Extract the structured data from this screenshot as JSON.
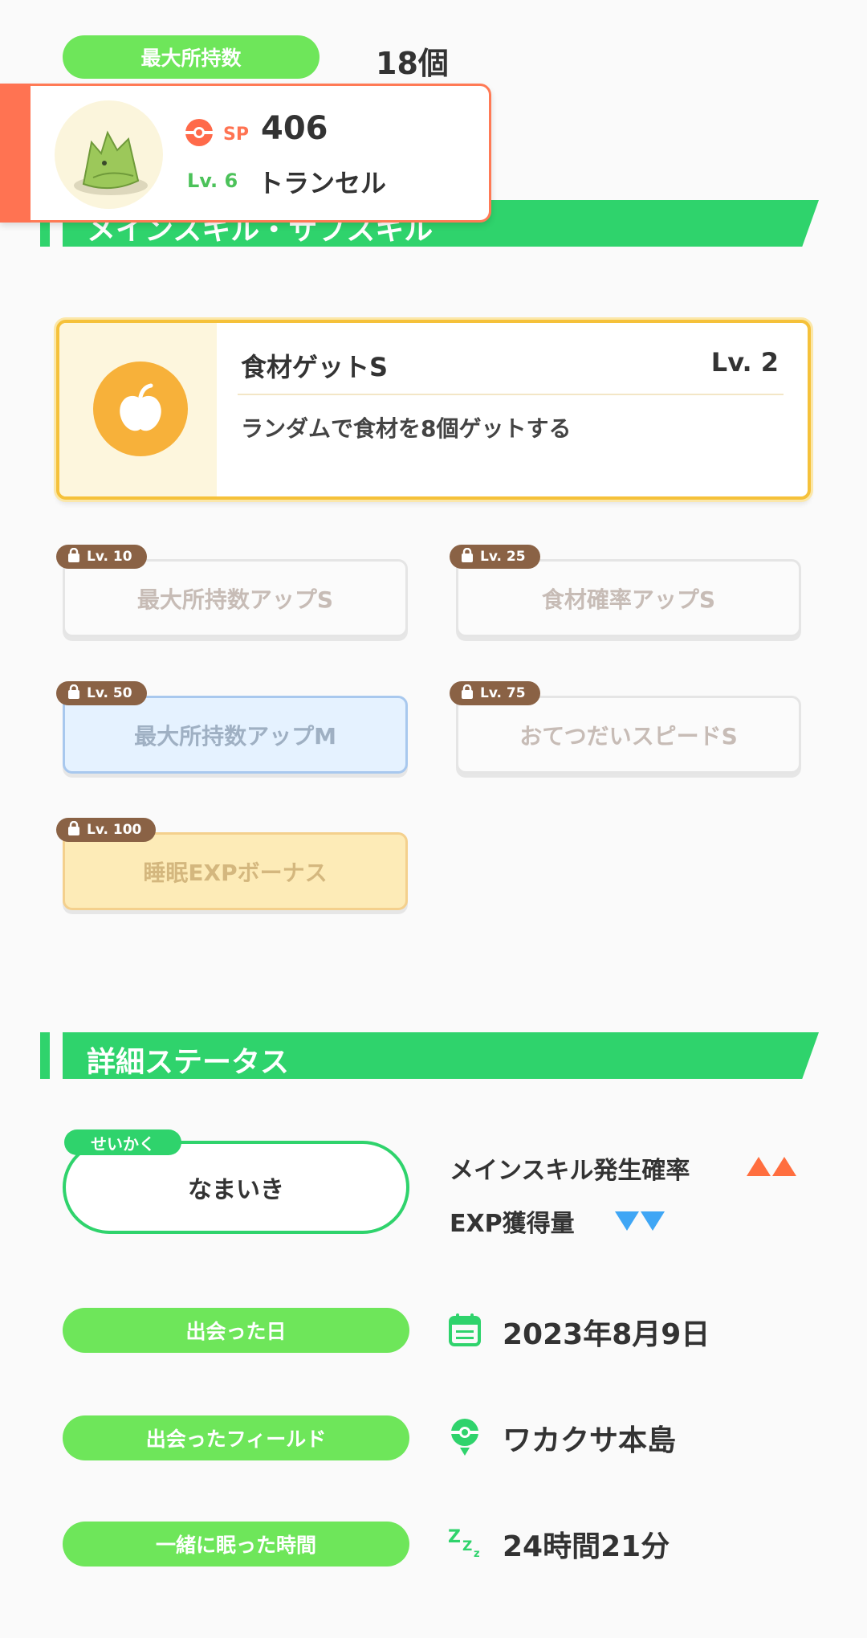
{
  "top": {
    "label": "最大所持数",
    "value": "18個"
  },
  "pokemon": {
    "sp_label": "SP",
    "sp_value": "406",
    "level_label": "Lv. 6",
    "name": "トランセル",
    "icon": "pokeball-icon"
  },
  "section1": {
    "title": "メインスキル・サブスキル"
  },
  "main_skill": {
    "name": "食材ゲットS",
    "level": "Lv. 2",
    "description": "ランダムで食材を8個ゲットする",
    "icon": "apple-icon"
  },
  "sub_skills": [
    {
      "unlock": "Lv. 10",
      "name": "最大所持数アップS",
      "style": "white"
    },
    {
      "unlock": "Lv. 25",
      "name": "食材確率アップS",
      "style": "white"
    },
    {
      "unlock": "Lv. 50",
      "name": "最大所持数アップM",
      "style": "blue"
    },
    {
      "unlock": "Lv. 75",
      "name": "おてつだいスピードS",
      "style": "white"
    },
    {
      "unlock": "Lv. 100",
      "name": "睡眠EXPボーナス",
      "style": "gold"
    }
  ],
  "section2": {
    "title": "詳細ステータス"
  },
  "nature": {
    "tag": "せいかく",
    "value": "なまいき",
    "effects": [
      {
        "label": "メインスキル発生確率",
        "direction": "up",
        "color": "#ff6e3f"
      },
      {
        "label": "EXP獲得量",
        "direction": "down",
        "color": "#3fa6f5"
      }
    ]
  },
  "details": {
    "met_date": {
      "label": "出会った日",
      "value": "2023年8月9日",
      "icon": "calendar-icon"
    },
    "met_field": {
      "label": "出会ったフィールド",
      "value": "ワカクサ本島",
      "icon": "location-pin-icon"
    },
    "slept_time": {
      "label": "一緒に眠った時間",
      "value": "24時間21分",
      "icon": "sleep-zzz-icon"
    }
  },
  "colors": {
    "green": "#2fd36c",
    "pill_green": "#6ee65a",
    "accent_orange": "#ff7352",
    "gold": "#f5c13a"
  }
}
